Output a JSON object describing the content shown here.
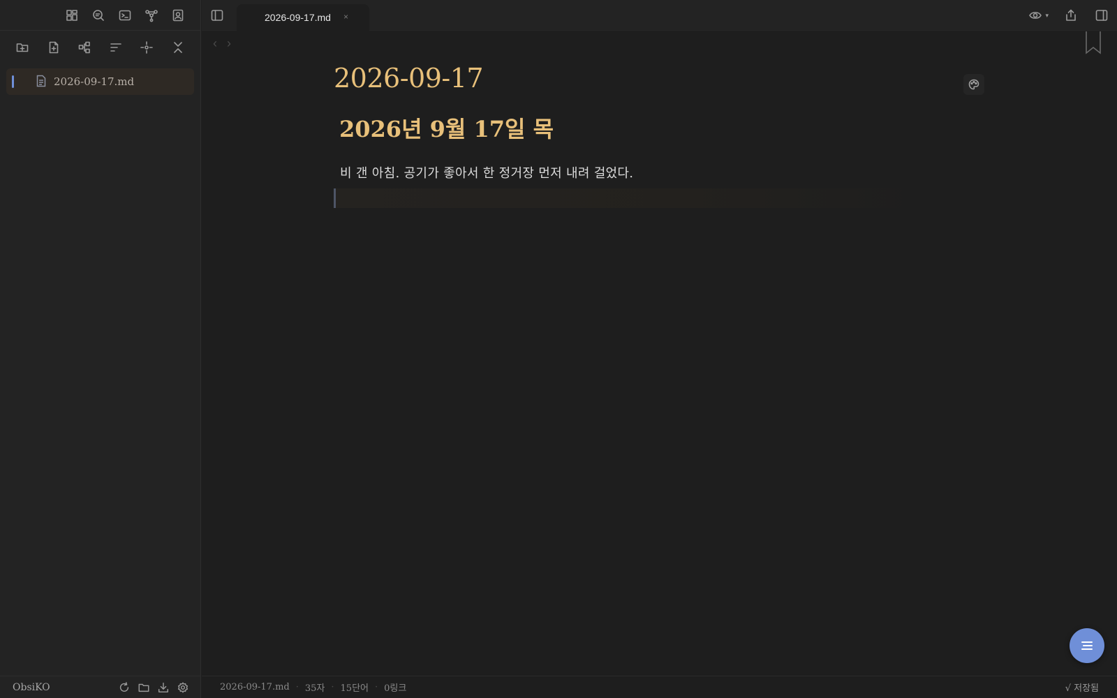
{
  "sidebar": {
    "ribbon_icons": [
      "layout-grid-icon",
      "search-icon",
      "terminal-icon",
      "graph-icon",
      "contact-icon"
    ],
    "tools": [
      "new-folder-icon",
      "new-note-icon",
      "tree-icon",
      "sort-icon",
      "locate-icon",
      "collapse-icon"
    ],
    "files": [
      {
        "name": "2026-09-17.md",
        "active": true
      }
    ],
    "vault_name": "ObsiKO",
    "bottom_icons": [
      "sync-icon",
      "folder-icon",
      "download-icon",
      "settings-icon"
    ]
  },
  "tab": {
    "title": "2026-09-17.md",
    "close": "×"
  },
  "nav": {
    "back": "‹",
    "forward": "›"
  },
  "editor": {
    "inline_title": "2026-09-17",
    "heading": "2026년 9월 17일 목",
    "paragraph": "비 갠 아침. 공기가 좋아서 한 정거장 먼저 내려 걸었다."
  },
  "status": {
    "file": "2026-09-17.md",
    "chars": "35자",
    "words": "15단어",
    "links": "0링크",
    "saved": "√ 저장됨"
  },
  "colors": {
    "accent": "#6f8fd8",
    "heading": "#e8c07a",
    "background": "#1e1e1e"
  }
}
